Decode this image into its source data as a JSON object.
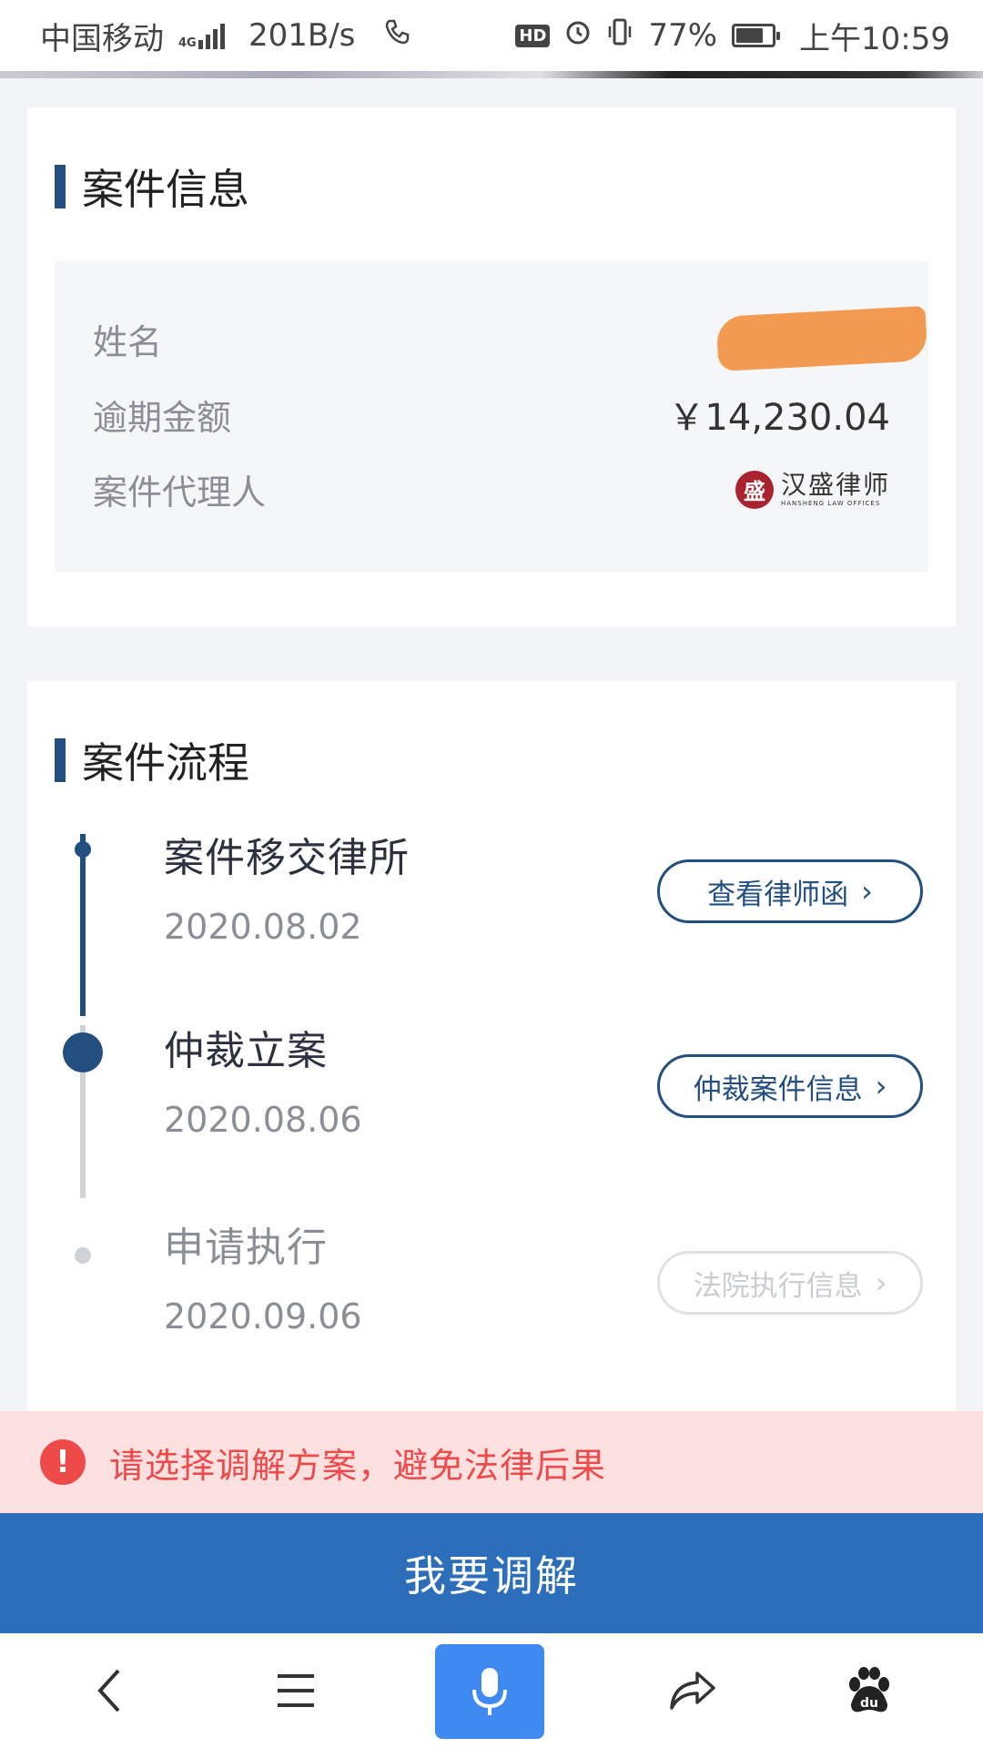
{
  "statusbar": {
    "carrier": "中国移动",
    "net_type": "4G",
    "speed": "201B/s",
    "hd": "HD",
    "battery_percent": "77%",
    "battery_level": 0.77,
    "time": "上午10:59"
  },
  "case_info": {
    "title": "案件信息",
    "rows": [
      {
        "label": "姓名",
        "value": ""
      },
      {
        "label": "逾期金额",
        "value": "￥14,230.04"
      },
      {
        "label": "案件代理人",
        "value": ""
      }
    ],
    "law_firm_logo": {
      "cn": "汉盛律师",
      "en": "HANSHENG LAW OFFICES",
      "seal": "盛"
    }
  },
  "case_process": {
    "title": "案件流程",
    "steps": [
      {
        "title": "案件移交律所",
        "date": "2020.08.02",
        "button": "查看律师函",
        "enabled": true
      },
      {
        "title": "仲裁立案",
        "date": "2020.08.06",
        "button": "仲裁案件信息",
        "enabled": true
      },
      {
        "title": "申请执行",
        "date": "2020.09.06",
        "button": "法院执行信息",
        "enabled": false
      }
    ]
  },
  "warning": {
    "icon": "!",
    "text": "请选择调解方案，避免法律后果"
  },
  "main_button": {
    "label": "我要调解"
  },
  "bottom_nav": [
    "back-icon",
    "menu-icon",
    "mic-icon",
    "share-icon",
    "baidu-paw-icon"
  ],
  "colors": {
    "accent": "#234f80",
    "button": "#2d6eba",
    "warn_bg": "#fde0e0",
    "warn_text": "#ee4a4a",
    "redaction": "#f29a52"
  }
}
